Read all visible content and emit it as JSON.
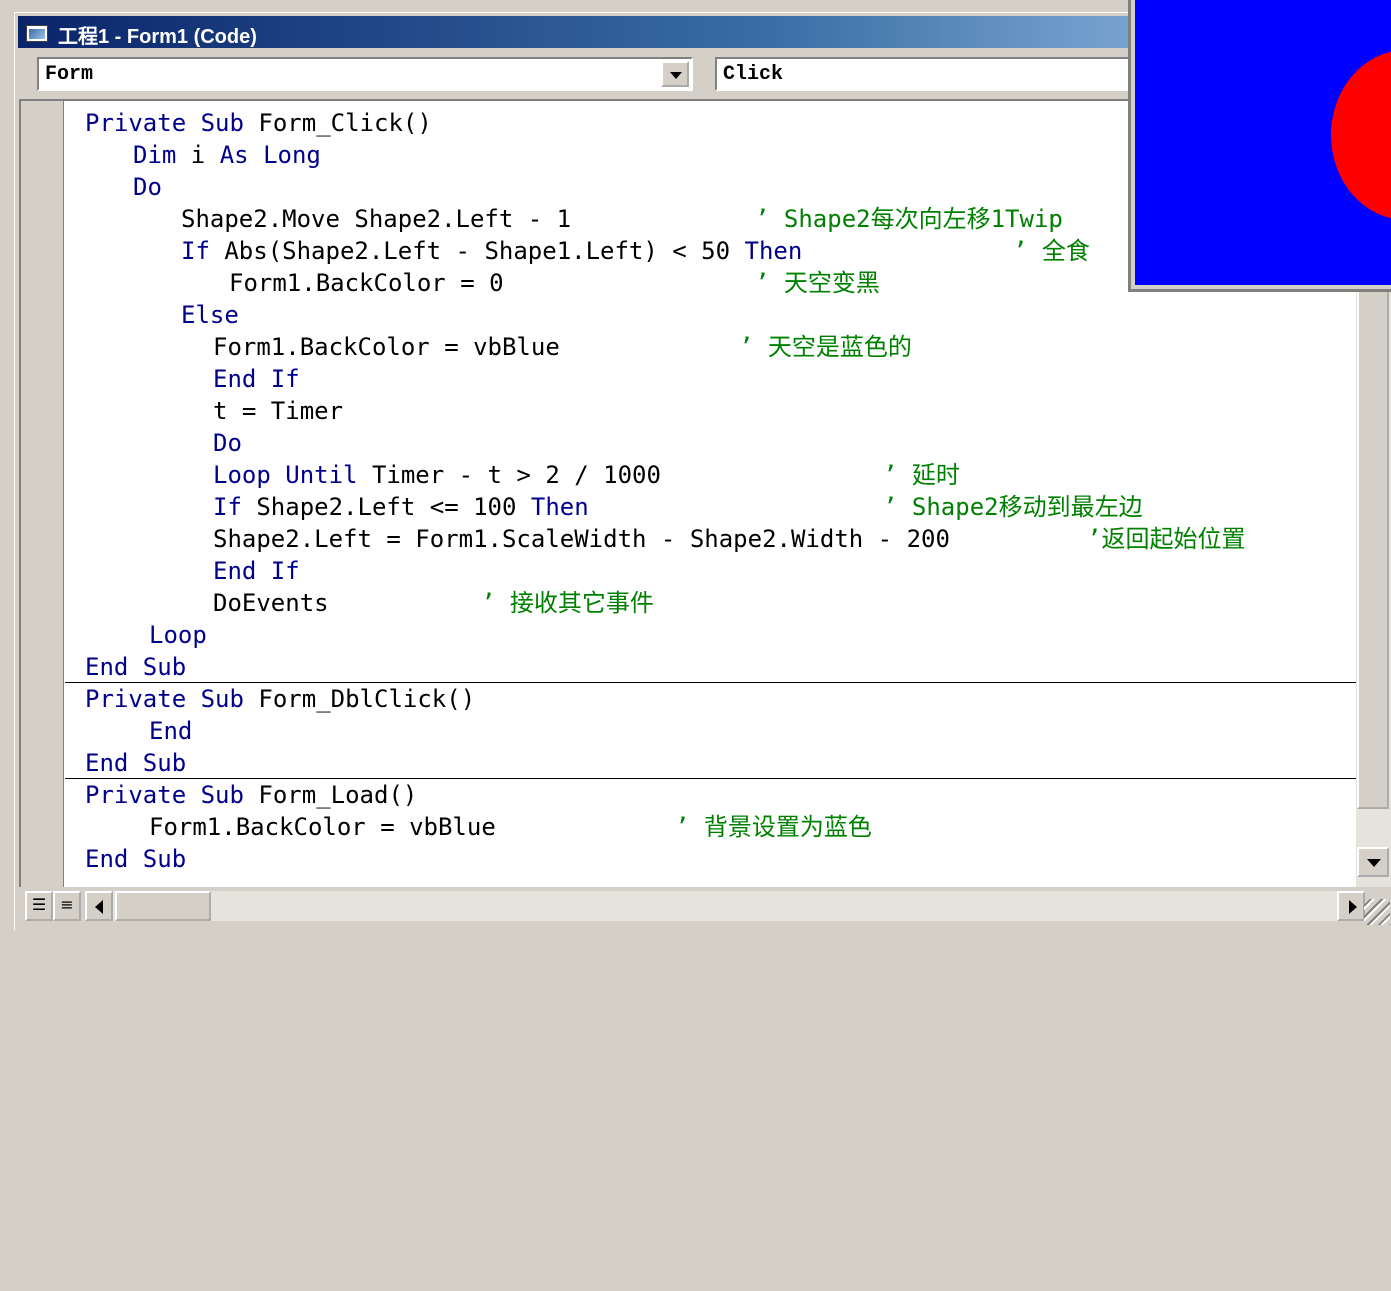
{
  "window": {
    "title": "工程1 - Form1 (Code)"
  },
  "object_combo": {
    "value": "Form"
  },
  "procedure_combo": {
    "value": "Click"
  },
  "code": {
    "l1": {
      "kw1": "Private Sub",
      "tx1": " Form_Click()"
    },
    "l2": {
      "kw1": "Dim",
      "tx1": " i ",
      "kw2": "As Long"
    },
    "l3": {
      "kw1": "Do"
    },
    "l4": {
      "tx1": "Shape2.Move Shape2.Left - 1",
      "cm": "’ Shape2每次向左移1Twip"
    },
    "l5": {
      "kw1": "If",
      "tx1": " Abs(Shape2.Left - Shape1.Left) < 50 ",
      "kw2": "Then",
      "cm": "’ 全食"
    },
    "l6": {
      "tx1": "Form1.BackColor = 0",
      "cm": "’ 天空变黑"
    },
    "l7": {
      "kw1": "Else"
    },
    "l8": {
      "tx1": "Form1.BackColor = vbBlue",
      "cm": "’ 天空是蓝色的"
    },
    "l9": {
      "kw1": "End If"
    },
    "l10": {
      "tx1": "t = Timer"
    },
    "l11": {
      "kw1": "Do"
    },
    "l12": {
      "kw1": "Loop Until",
      "tx1": " Timer - t > 2 / 1000",
      "cm": "’ 延时"
    },
    "l13": {
      "kw1": "If",
      "tx1": " Shape2.Left <= 100 ",
      "kw2": "Then",
      "cm": "’ Shape2移动到最左边"
    },
    "l14": {
      "tx1": "Shape2.Left = Form1.ScaleWidth - Shape2.Width - 200",
      "cm": "’返回起始位置"
    },
    "l15": {
      "kw1": "End If"
    },
    "l16": {
      "tx1": "DoEvents",
      "cm": "’ 接收其它事件"
    },
    "l17": {
      "kw1": "Loop"
    },
    "l18": {
      "kw1": "End Sub"
    },
    "l19": {
      "kw1": "Private Sub",
      "tx1": " Form_DblClick()"
    },
    "l20": {
      "kw1": "End"
    },
    "l21": {
      "kw1": "End Sub"
    },
    "l22": {
      "kw1": "Private Sub",
      "tx1": " Form_Load()"
    },
    "l23": {
      "tx1": "Form1.BackColor = vbBlue",
      "cm": "’ 背景设置为蓝色"
    },
    "l24": {
      "kw1": "End Sub"
    }
  },
  "icons": {
    "app": "vb-form-icon",
    "dropdown": "chevron-down-icon",
    "procedure_view": "procedure-view-icon",
    "full_module_view": "full-module-view-icon"
  },
  "colors": {
    "keyword": "#00008b",
    "comment": "#008000",
    "text": "#000000",
    "sky": "#0000ff",
    "sun": "#ff0000",
    "titlebar_start": "#0a246a",
    "titlebar_end": "#a6caf0"
  }
}
